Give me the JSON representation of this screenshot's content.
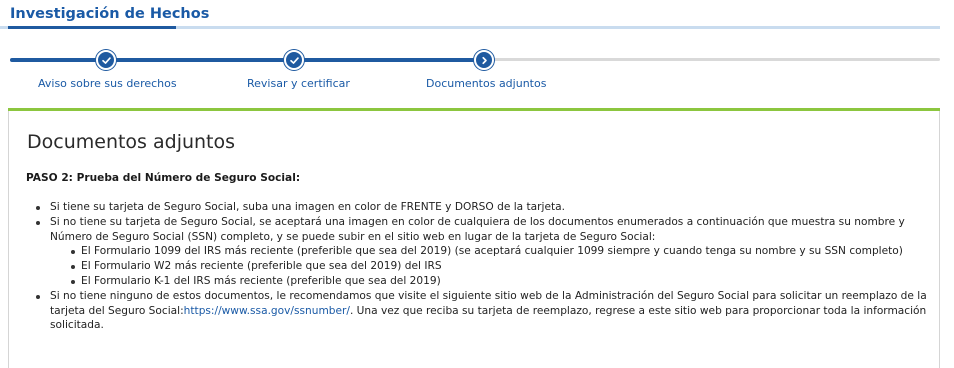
{
  "header": {
    "title": "Investigación de Hechos"
  },
  "stepper": {
    "steps": [
      {
        "label": "Aviso sobre sus derechos",
        "status": "completed",
        "icon": "check-icon"
      },
      {
        "label": "Revisar y certificar",
        "status": "completed",
        "icon": "check-icon"
      },
      {
        "label": "Documentos adjuntos",
        "status": "current",
        "icon": "chevron-right-icon"
      }
    ]
  },
  "main": {
    "title": "Documentos adjuntos",
    "step_heading": "PASO 2: Prueba del Número de Seguro Social:",
    "bullets": {
      "b1": "Si tiene su tarjeta de Seguro Social, suba una imagen en color de FRENTE y DORSO de la tarjeta.",
      "b2": "Si no tiene su tarjeta de Seguro Social, se aceptará una imagen en color de cualquiera de los documentos enumerados a continuación que muestra su nombre y Número de Seguro Social (SSN) completo, y se puede subir en el sitio web en lugar de la tarjeta de Seguro Social:",
      "sub": [
        "El Formulario 1099 del IRS más reciente (preferible que sea del 2019) (se aceptará cualquier 1099 siempre y cuando tenga su nombre y su SSN completo)",
        "El Formulario W2 más reciente (preferible que sea del 2019) del IRS",
        "El Formulario K-1 del IRS más reciente (preferible que sea del 2019)"
      ],
      "b3_before": "Si no tiene ninguno de estos documentos, le recomendamos que visite el siguiente sitio web de la Administración del Seguro Social para solicitar un reemplazo de la tarjeta del Seguro Social:",
      "b3_link": "https://www.ssa.gov/ssnumber/",
      "b3_after": ". Una vez que reciba su tarjeta de reemplazo, regrese a este sitio web para proporcionar toda la información solicitada."
    }
  },
  "colors": {
    "primary": "#1f5aa0",
    "link": "#1a5aa6",
    "accent_green": "#8cc63f",
    "track_inactive": "#d9d9d9"
  }
}
